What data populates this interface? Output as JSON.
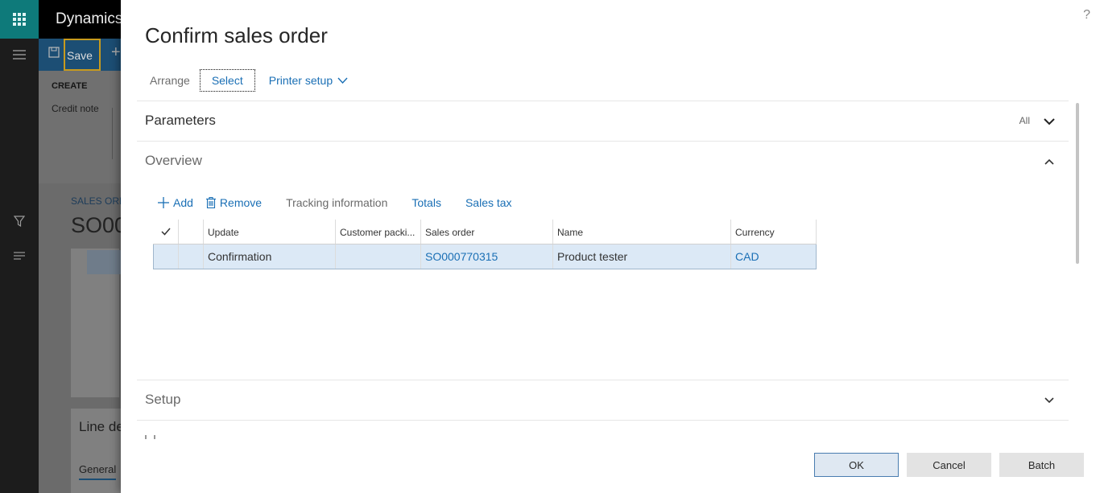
{
  "background": {
    "app_title": "Dynamics",
    "actions": {
      "save_label": "Save",
      "add_glyph": "+"
    },
    "ribbon": {
      "group": "CREATE",
      "item": "Credit note"
    },
    "page": {
      "caption": "SALES ORD",
      "order_number": "SO00"
    },
    "line_details": {
      "title": "Line de",
      "tab": "General"
    }
  },
  "dialog": {
    "title": "Confirm sales order",
    "help_glyph": "?",
    "toolbar": {
      "arrange": "Arrange",
      "select": "Select",
      "printer_setup": "Printer setup"
    },
    "fasttabs": {
      "parameters": {
        "title": "Parameters",
        "summary": "All"
      },
      "overview": {
        "title": "Overview",
        "toolbar": {
          "add": "Add",
          "remove": "Remove",
          "tracking": "Tracking information",
          "totals": "Totals",
          "sales_tax": "Sales tax"
        },
        "grid": {
          "columns": [
            "Update",
            "Customer packi...",
            "Sales order",
            "Name",
            "Currency"
          ],
          "rows": [
            {
              "update": "Confirmation",
              "customer_packing": "",
              "sales_order": "SO000770315",
              "name": "Product tester",
              "currency": "CAD"
            }
          ]
        }
      },
      "setup": {
        "title": "Setup"
      }
    },
    "footer": {
      "ok": "OK",
      "cancel": "Cancel",
      "batch": "Batch"
    }
  },
  "colors": {
    "accent": "#1a6fb5",
    "topbar": "#000000",
    "waffle": "#0e7a7a",
    "action_bar": "#1c4e74",
    "selected_row": "#dce9f6"
  }
}
